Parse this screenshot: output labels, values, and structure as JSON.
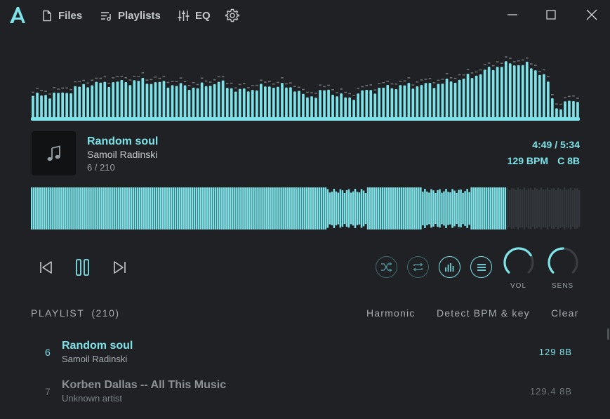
{
  "nav": {
    "files": "Files",
    "playlists": "Playlists",
    "eq": "EQ"
  },
  "colors": {
    "accent": "#7ee3e8",
    "background": "#1f2124",
    "muted": "#3e6a6e"
  },
  "now_playing": {
    "title": "Random soul",
    "artist": "Samoil Radinski",
    "index": "6 / 210",
    "time": "4:49 / 5:34",
    "bpm": "129 BPM",
    "key": "C 8B",
    "progress": 0.862
  },
  "controls": {
    "volume_label": "VOL",
    "sensitivity_label": "SENS",
    "volume_level": 0.72,
    "sensitivity_level": 0.5,
    "shuffle_active": false,
    "repeat_active": false,
    "visualizer_active": true,
    "menu_active": true
  },
  "playlist": {
    "label": "PLAYLIST",
    "count": "(210)",
    "actions": {
      "harmonic": "Harmonic",
      "detect": "Detect BPM & key",
      "clear": "Clear"
    },
    "rows": [
      {
        "num": "6",
        "title": "Random soul",
        "artist": "Samoil Radinski",
        "meta": "129 8B",
        "active": true
      },
      {
        "num": "7",
        "title": "Korben Dallas -- All This Music",
        "artist": "Unknown artist",
        "meta": "129.4 8B",
        "active": false
      }
    ]
  },
  "icons": {
    "logo": "app-logo",
    "files": "file-icon",
    "playlists": "playlist-icon",
    "eq": "sliders-icon",
    "settings": "gear-icon",
    "previous": "skip-previous-icon",
    "pause": "pause-icon",
    "next": "skip-next-icon",
    "shuffle": "shuffle-icon",
    "repeat": "repeat-icon",
    "visualizer": "bar-chart-icon",
    "menu": "menu-icon"
  }
}
